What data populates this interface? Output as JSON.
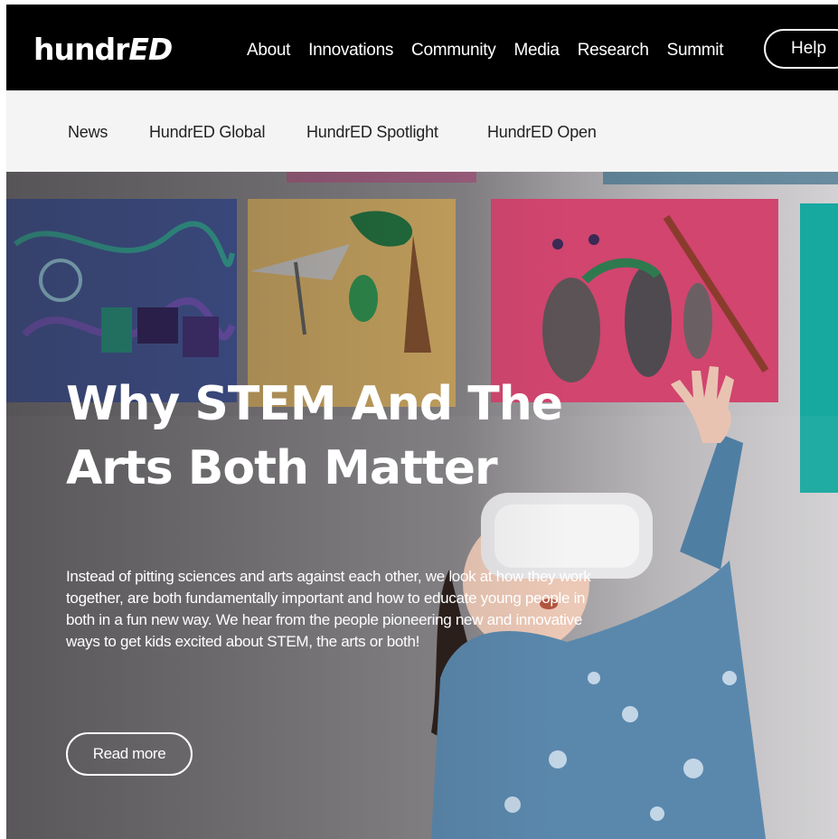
{
  "header": {
    "logo_main": "hundr",
    "logo_accent": "ED",
    "nav": [
      "About",
      "Innovations",
      "Community",
      "Media",
      "Research",
      "Summit"
    ],
    "help_label": "Help"
  },
  "subnav": {
    "tabs": [
      "News",
      "HundrED Global",
      "HundrED Spotlight",
      "HundrED Open"
    ],
    "active_tab": "News",
    "accent_color": "#d62b8c"
  },
  "hero": {
    "headline_line1": "Why STEM And The",
    "headline_line2": "Arts Both Matter",
    "lede": "Instead of pitting sciences and arts against each other, we look at how they work together, are both fundamentally important and how to educate young people in both in a fun new way. We hear from the people pioneering new and innovative ways to get kids excited about STEM, the arts or both!",
    "button_label": "Read more"
  }
}
